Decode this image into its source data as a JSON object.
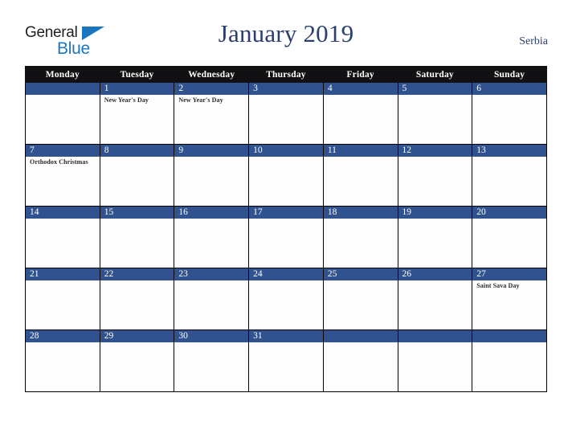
{
  "brand": {
    "name_part1": "General",
    "name_part2": "Blue",
    "triangle_color": "#1b75bc",
    "text_color": "#231f20"
  },
  "header": {
    "title": "January 2019",
    "region": "Serbia",
    "title_color": "#2b3f6c"
  },
  "calendar": {
    "month": "January",
    "year": "2019",
    "accent_blue": "#30538f",
    "header_bg": "#111114",
    "weekdays": [
      "Monday",
      "Tuesday",
      "Wednesday",
      "Thursday",
      "Friday",
      "Saturday",
      "Sunday"
    ],
    "weeks": [
      [
        {
          "date": "",
          "events": []
        },
        {
          "date": "1",
          "events": [
            "New Year's Day"
          ]
        },
        {
          "date": "2",
          "events": [
            "New Year's Day"
          ]
        },
        {
          "date": "3",
          "events": []
        },
        {
          "date": "4",
          "events": []
        },
        {
          "date": "5",
          "events": []
        },
        {
          "date": "6",
          "events": []
        }
      ],
      [
        {
          "date": "7",
          "events": [
            "Orthodox Christmas"
          ]
        },
        {
          "date": "8",
          "events": []
        },
        {
          "date": "9",
          "events": []
        },
        {
          "date": "10",
          "events": []
        },
        {
          "date": "11",
          "events": []
        },
        {
          "date": "12",
          "events": []
        },
        {
          "date": "13",
          "events": []
        }
      ],
      [
        {
          "date": "14",
          "events": []
        },
        {
          "date": "15",
          "events": []
        },
        {
          "date": "16",
          "events": []
        },
        {
          "date": "17",
          "events": []
        },
        {
          "date": "18",
          "events": []
        },
        {
          "date": "19",
          "events": []
        },
        {
          "date": "20",
          "events": []
        }
      ],
      [
        {
          "date": "21",
          "events": []
        },
        {
          "date": "22",
          "events": []
        },
        {
          "date": "23",
          "events": []
        },
        {
          "date": "24",
          "events": []
        },
        {
          "date": "25",
          "events": []
        },
        {
          "date": "26",
          "events": []
        },
        {
          "date": "27",
          "events": [
            "Saint Sava Day"
          ]
        }
      ],
      [
        {
          "date": "28",
          "events": []
        },
        {
          "date": "29",
          "events": []
        },
        {
          "date": "30",
          "events": []
        },
        {
          "date": "31",
          "events": []
        },
        {
          "date": "",
          "events": []
        },
        {
          "date": "",
          "events": []
        },
        {
          "date": "",
          "events": []
        }
      ]
    ]
  }
}
